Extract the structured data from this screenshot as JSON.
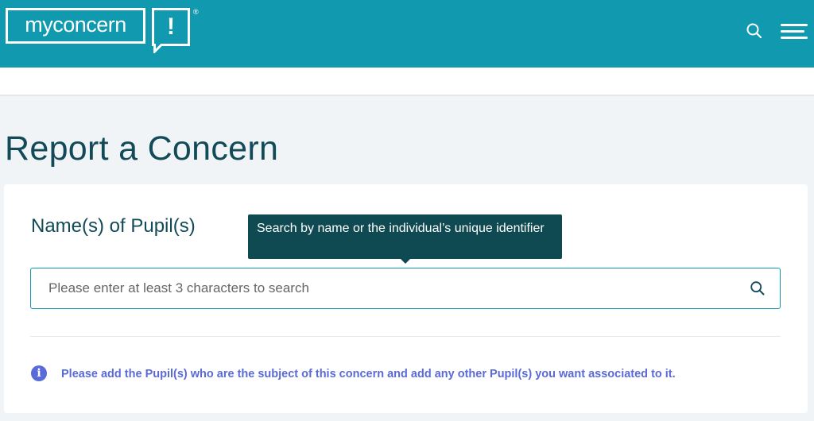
{
  "header": {
    "logo_text": "myconcern",
    "logo_mark": "!",
    "logo_registered": "®",
    "search_icon": "search-icon",
    "menu_icon": "hamburger-menu-icon",
    "brand_color": "#1199af"
  },
  "page": {
    "title": "Report a Concern"
  },
  "form": {
    "field_label": "Name(s) of Pupil(s)",
    "tooltip": "Search by name or the individual’s unique identifier",
    "search_placeholder": "Please enter at least 3 characters to search",
    "search_value": "",
    "info_icon": "info-icon",
    "info_text": "Please add the Pupil(s) who are the subject of this concern and add any other Pupil(s) you want associated to it.",
    "accent_color": "#5a6ad8",
    "title_color": "#124a58"
  }
}
